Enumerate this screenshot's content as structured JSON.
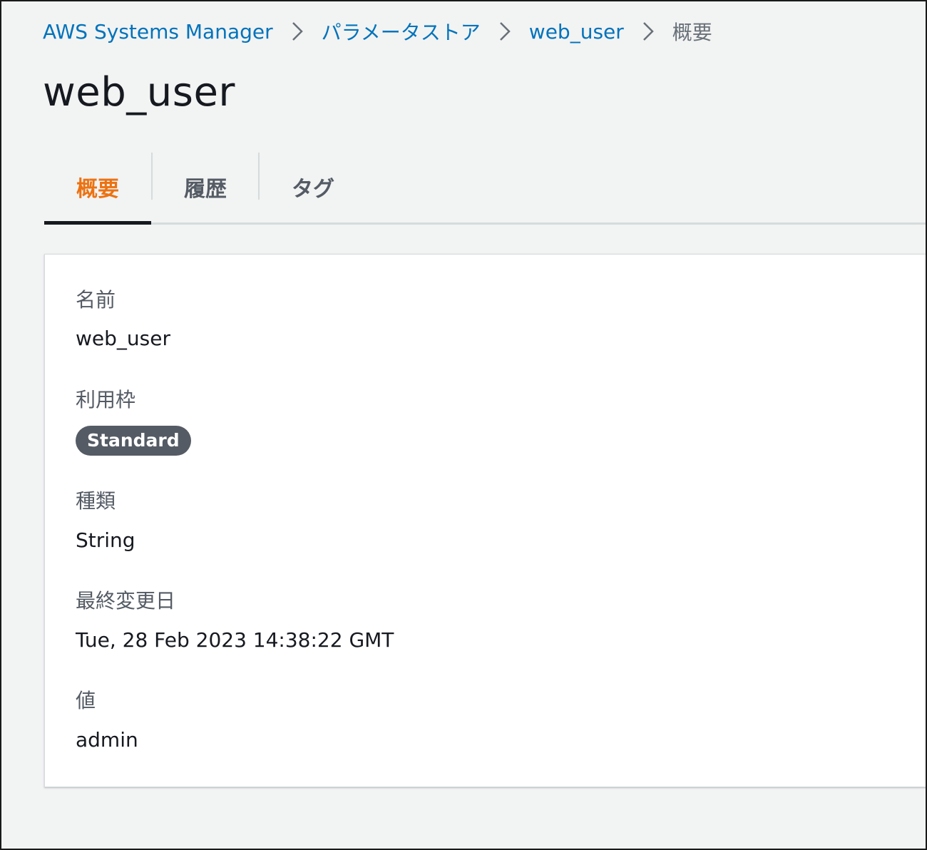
{
  "breadcrumb": {
    "items": [
      {
        "label": "AWS Systems Manager"
      },
      {
        "label": "パラメータストア"
      },
      {
        "label": "web_user"
      }
    ],
    "current": "概要"
  },
  "page": {
    "title": "web_user"
  },
  "tabs": [
    {
      "label": "概要",
      "active": true
    },
    {
      "label": "履歴",
      "active": false
    },
    {
      "label": "タグ",
      "active": false
    }
  ],
  "details": {
    "name_label": "名前",
    "name_value": "web_user",
    "tier_label": "利用枠",
    "tier_value": "Standard",
    "type_label": "種類",
    "type_value": "String",
    "modified_label": "最終変更日",
    "modified_value": "Tue, 28 Feb 2023 14:38:22 GMT",
    "value_label": "値",
    "value_value": "admin"
  },
  "colors": {
    "link": "#0073bb",
    "active_tab": "#ec7211",
    "badge_bg": "#545b64",
    "background": "#f2f3f3"
  },
  "icons": {
    "breadcrumb_separator": "chevron-right-icon"
  }
}
